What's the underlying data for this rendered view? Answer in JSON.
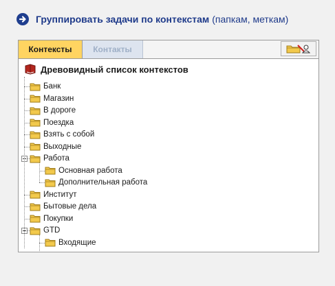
{
  "heading": {
    "main": "Группировать задачи по контекстам",
    "sub": "(папкам, меткам)"
  },
  "tabs": {
    "active": "Контексты",
    "inactive": "Контакты"
  },
  "tree": {
    "title": "Древовидный список контекстов",
    "items": [
      {
        "label": "Банк",
        "level": 1
      },
      {
        "label": "Магазин",
        "level": 1
      },
      {
        "label": "В дороге",
        "level": 1
      },
      {
        "label": "Поездка",
        "level": 1
      },
      {
        "label": "Взять с собой",
        "level": 1
      },
      {
        "label": "Выходные",
        "level": 1
      },
      {
        "label": "Работа",
        "level": 1,
        "expanded": true
      },
      {
        "label": "Основная работа",
        "level": 2
      },
      {
        "label": "Дополнительная работа",
        "level": 2
      },
      {
        "label": "Институт",
        "level": 1
      },
      {
        "label": "Бытовые дела",
        "level": 1
      },
      {
        "label": "Покупки",
        "level": 1
      },
      {
        "label": "GTD",
        "level": 1,
        "expanded": true
      },
      {
        "label": "Входящие",
        "level": 2
      }
    ]
  },
  "colors": {
    "heading": "#1e3a8a",
    "active_tab": "#ffd461",
    "folder": "#f2c94c"
  }
}
